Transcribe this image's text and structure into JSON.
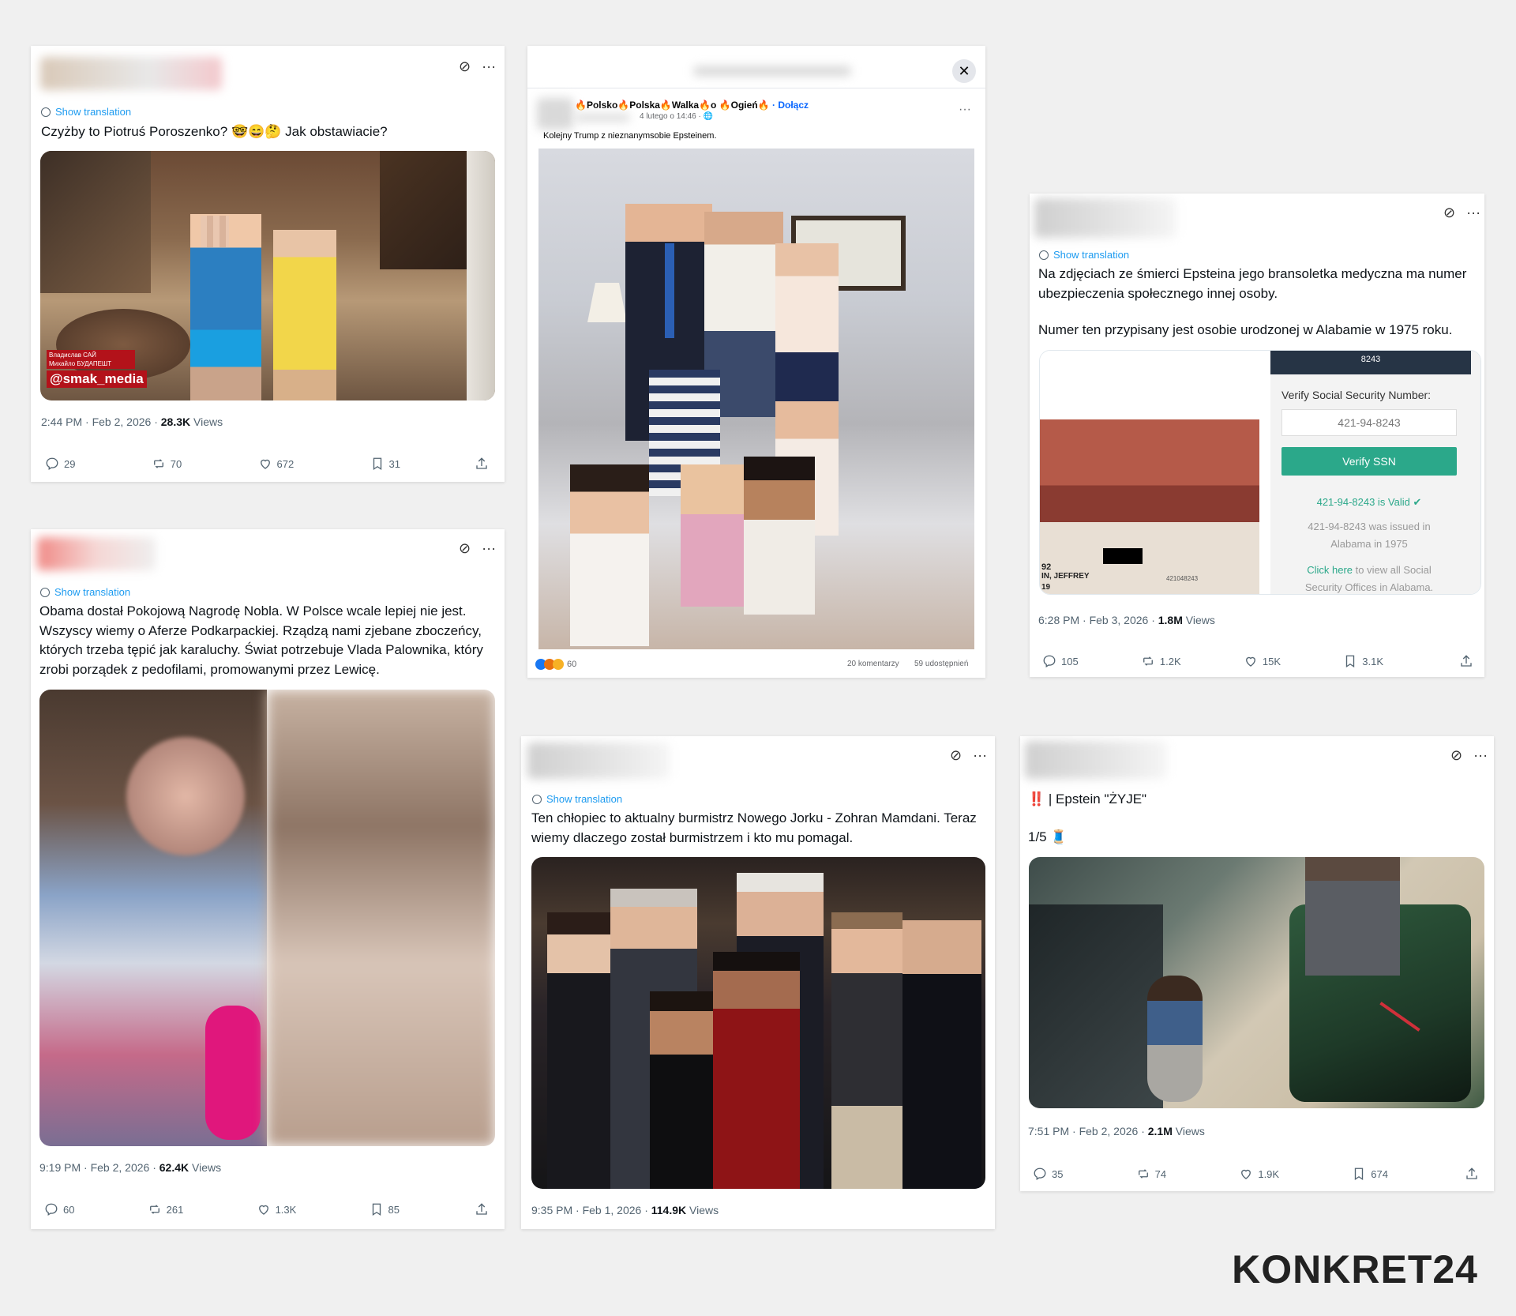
{
  "common": {
    "show_translation": "Show translation"
  },
  "post1": {
    "text": "Czyżby to Piotruś Poroszenko? 🤓😄🤔 Jak obstawiacie?",
    "watermark_line1": "Владислав САЙ",
    "watermark_line2": "Михайло БУДАПЕШТ",
    "watermark_handle": "@smak_media",
    "time": "2:44 PM · Feb 2, 2026 · ",
    "views_count": "28.3K",
    "views_label": " Views",
    "replies": "29",
    "reposts": "70",
    "likes": "672",
    "bookmarks": "31"
  },
  "post2": {
    "text": "Obama dostał Pokojową Nagrodę Nobla. W Polsce wcale lepiej nie jest. Wszyscy wiemy o Aferze Podkarpackiej. Rządzą nami zjebane zboczeńcy, których trzeba tępić jak karaluchy. Świat potrzebuje Vlada Palownika, który zrobi porządek z pedofilami, promowanymi przez Lewicę.",
    "time": "9:19 PM · Feb 2, 2026 · ",
    "views_count": "62.4K",
    "views_label": " Views",
    "replies": "60",
    "reposts": "261",
    "likes": "1.3K",
    "bookmarks": "85"
  },
  "fbpost": {
    "group_name": "🔥Polsko🔥Polska🔥Walka🔥o 🔥Ogień🔥",
    "join": "· Dołącz",
    "date": "4 lutego o 14:46 · 🌐",
    "caption": "Kolejny Trump z nieznanymsobie Epsteinem.",
    "reactions": "60",
    "comments": "20 komentarzy",
    "shares": "59 udostępnień"
  },
  "post3": {
    "text_line1": "Na zdjęciach ze śmierci Epsteina jego bransoletka medyczna ma numer ubezpieczenia społecznego innej osoby.",
    "text_line2": "Numer ten przypisany jest osobie urodzonej w Alabamie w 1975 roku.",
    "ssn_panel_header": "8243",
    "ssn_label": "Verify Social Security Number:",
    "ssn_value": "421-94-8243",
    "ssn_button": "Verify SSN",
    "ssn_valid": "421-94-8243 is Valid ✔",
    "ssn_issued": "421-94-8243 was issued in Alabama in 1975",
    "ssn_link": "Click here",
    "ssn_link_rest": " to view all Social Security Offices in Alabama.",
    "band_text1": "92",
    "band_text2": "IN, JEFFREY",
    "band_text3": "19",
    "band_text4": "421048243",
    "time": "6:28 PM · Feb 3, 2026 · ",
    "views_count": "1.8M",
    "views_label": " Views",
    "replies": "105",
    "reposts": "1.2K",
    "likes": "15K",
    "bookmarks": "3.1K"
  },
  "post4": {
    "text": "Ten chłopiec to aktualny burmistrz Nowego Jorku - Zohran Mamdani. Teraz wiemy dlaczego został burmistrzem i kto mu pomagal.",
    "time": "9:35 PM · Feb 1, 2026 · ",
    "views_count": "114.9K",
    "views_label": " Views"
  },
  "post5": {
    "text": "‼️ | Epstein \"ŻYJE\"",
    "sub": "1/5 🧵",
    "time": "7:51 PM · Feb 2, 2026 · ",
    "views_count": "2.1M",
    "views_label": " Views",
    "replies": "35",
    "reposts": "74",
    "likes": "1.9K",
    "bookmarks": "674"
  },
  "brand": {
    "logo": "KONKRET24"
  }
}
